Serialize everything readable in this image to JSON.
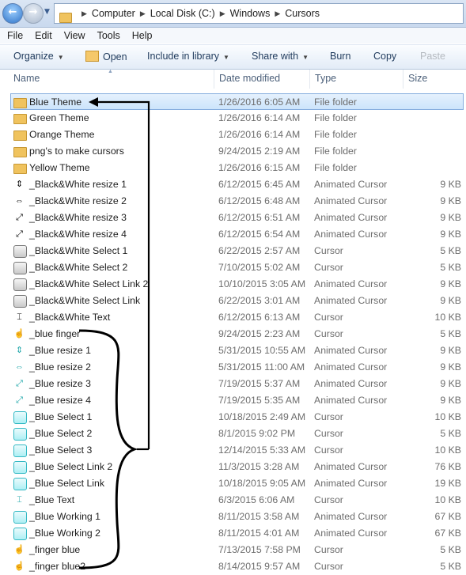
{
  "address": {
    "crumbs": [
      "Computer",
      "Local Disk (C:)",
      "Windows",
      "Cursors"
    ]
  },
  "menu": [
    "File",
    "Edit",
    "View",
    "Tools",
    "Help"
  ],
  "toolbar": {
    "organize": "Organize",
    "open": "Open",
    "include": "Include in library",
    "share": "Share with",
    "burn": "Burn",
    "copy": "Copy",
    "paste": "Paste"
  },
  "columns": {
    "name": "Name",
    "date": "Date modified",
    "type": "Type",
    "size": "Size"
  },
  "files": [
    {
      "name": "Blue Theme",
      "date": "1/26/2016 6:05 AM",
      "type": "File folder",
      "size": "",
      "icon": "folder-icon",
      "selected": true
    },
    {
      "name": "Green Theme",
      "date": "1/26/2016 6:14 AM",
      "type": "File folder",
      "size": "",
      "icon": "folder-icon"
    },
    {
      "name": "Orange Theme",
      "date": "1/26/2016 6:14 AM",
      "type": "File folder",
      "size": "",
      "icon": "folder-icon"
    },
    {
      "name": "png's to make cursors",
      "date": "9/24/2015 2:19 AM",
      "type": "File folder",
      "size": "",
      "icon": "folder-icon"
    },
    {
      "name": "Yellow Theme",
      "date": "1/26/2016 6:15 AM",
      "type": "File folder",
      "size": "",
      "icon": "folder-icon"
    },
    {
      "name": "_Black&White resize 1",
      "date": "6/12/2015 6:45 AM",
      "type": "Animated Cursor",
      "size": "9 KB",
      "icon": "resize-vertical-icon"
    },
    {
      "name": "_Black&White resize 2",
      "date": "6/12/2015 6:48 AM",
      "type": "Animated Cursor",
      "size": "9 KB",
      "icon": "resize-horizontal-icon"
    },
    {
      "name": "_Black&White resize 3",
      "date": "6/12/2015 6:51 AM",
      "type": "Animated Cursor",
      "size": "9 KB",
      "icon": "resize-diagonal-icon"
    },
    {
      "name": "_Black&White resize 4",
      "date": "6/12/2015 6:54 AM",
      "type": "Animated Cursor",
      "size": "9 KB",
      "icon": "resize-diagonal-icon"
    },
    {
      "name": "_Black&White Select 1",
      "date": "6/22/2015 2:57 AM",
      "type": "Cursor",
      "size": "5 KB",
      "icon": "cursor-square-icon"
    },
    {
      "name": "_Black&White Select 2",
      "date": "7/10/2015 5:02 AM",
      "type": "Cursor",
      "size": "5 KB",
      "icon": "cursor-square-icon"
    },
    {
      "name": "_Black&White Select Link 2",
      "date": "10/10/2015 3:05 AM",
      "type": "Animated Cursor",
      "size": "9 KB",
      "icon": "cursor-square-icon"
    },
    {
      "name": "_Black&White Select Link",
      "date": "6/22/2015 3:01 AM",
      "type": "Animated Cursor",
      "size": "9 KB",
      "icon": "cursor-square-icon"
    },
    {
      "name": "_Black&White Text",
      "date": "6/12/2015 6:13 AM",
      "type": "Cursor",
      "size": "10 KB",
      "icon": "text-cursor-icon"
    },
    {
      "name": "_blue finger",
      "date": "9/24/2015 2:23 AM",
      "type": "Cursor",
      "size": "5 KB",
      "icon": "hand-icon"
    },
    {
      "name": "_Blue resize 1",
      "date": "5/31/2015 10:55 AM",
      "type": "Animated Cursor",
      "size": "9 KB",
      "icon": "resize-vertical-icon"
    },
    {
      "name": "_Blue resize 2",
      "date": "5/31/2015 11:00 AM",
      "type": "Animated Cursor",
      "size": "9 KB",
      "icon": "resize-horizontal-icon"
    },
    {
      "name": "_Blue resize 3",
      "date": "7/19/2015 5:37 AM",
      "type": "Animated Cursor",
      "size": "9 KB",
      "icon": "resize-diagonal-icon"
    },
    {
      "name": "_Blue resize 4",
      "date": "7/19/2015 5:35 AM",
      "type": "Animated Cursor",
      "size": "9 KB",
      "icon": "resize-diagonal-icon"
    },
    {
      "name": "_Blue Select 1",
      "date": "10/18/2015 2:49 AM",
      "type": "Cursor",
      "size": "10 KB",
      "icon": "cursor-square-icon"
    },
    {
      "name": "_Blue Select 2",
      "date": "8/1/2015 9:02 PM",
      "type": "Cursor",
      "size": "5 KB",
      "icon": "cursor-square-icon"
    },
    {
      "name": "_Blue Select 3",
      "date": "12/14/2015 5:33 AM",
      "type": "Cursor",
      "size": "10 KB",
      "icon": "cursor-square-icon"
    },
    {
      "name": "_Blue Select Link 2",
      "date": "11/3/2015 3:28 AM",
      "type": "Animated Cursor",
      "size": "76 KB",
      "icon": "cursor-square-icon"
    },
    {
      "name": "_Blue Select Link",
      "date": "10/18/2015 9:05 AM",
      "type": "Animated Cursor",
      "size": "19 KB",
      "icon": "cursor-square-icon"
    },
    {
      "name": "_Blue Text",
      "date": "6/3/2015 6:06 AM",
      "type": "Cursor",
      "size": "10 KB",
      "icon": "text-cursor-icon"
    },
    {
      "name": "_Blue Working 1",
      "date": "8/11/2015 3:58 AM",
      "type": "Animated Cursor",
      "size": "67 KB",
      "icon": "cursor-square-icon"
    },
    {
      "name": "_Blue Working 2",
      "date": "8/11/2015 4:01 AM",
      "type": "Animated Cursor",
      "size": "67 KB",
      "icon": "cursor-square-icon"
    },
    {
      "name": "_finger blue",
      "date": "7/13/2015 7:58 PM",
      "type": "Cursor",
      "size": "5 KB",
      "icon": "hand-icon"
    },
    {
      "name": "_finger blue2",
      "date": "8/14/2015 9:57 AM",
      "type": "Cursor",
      "size": "5 KB",
      "icon": "hand-icon"
    }
  ]
}
